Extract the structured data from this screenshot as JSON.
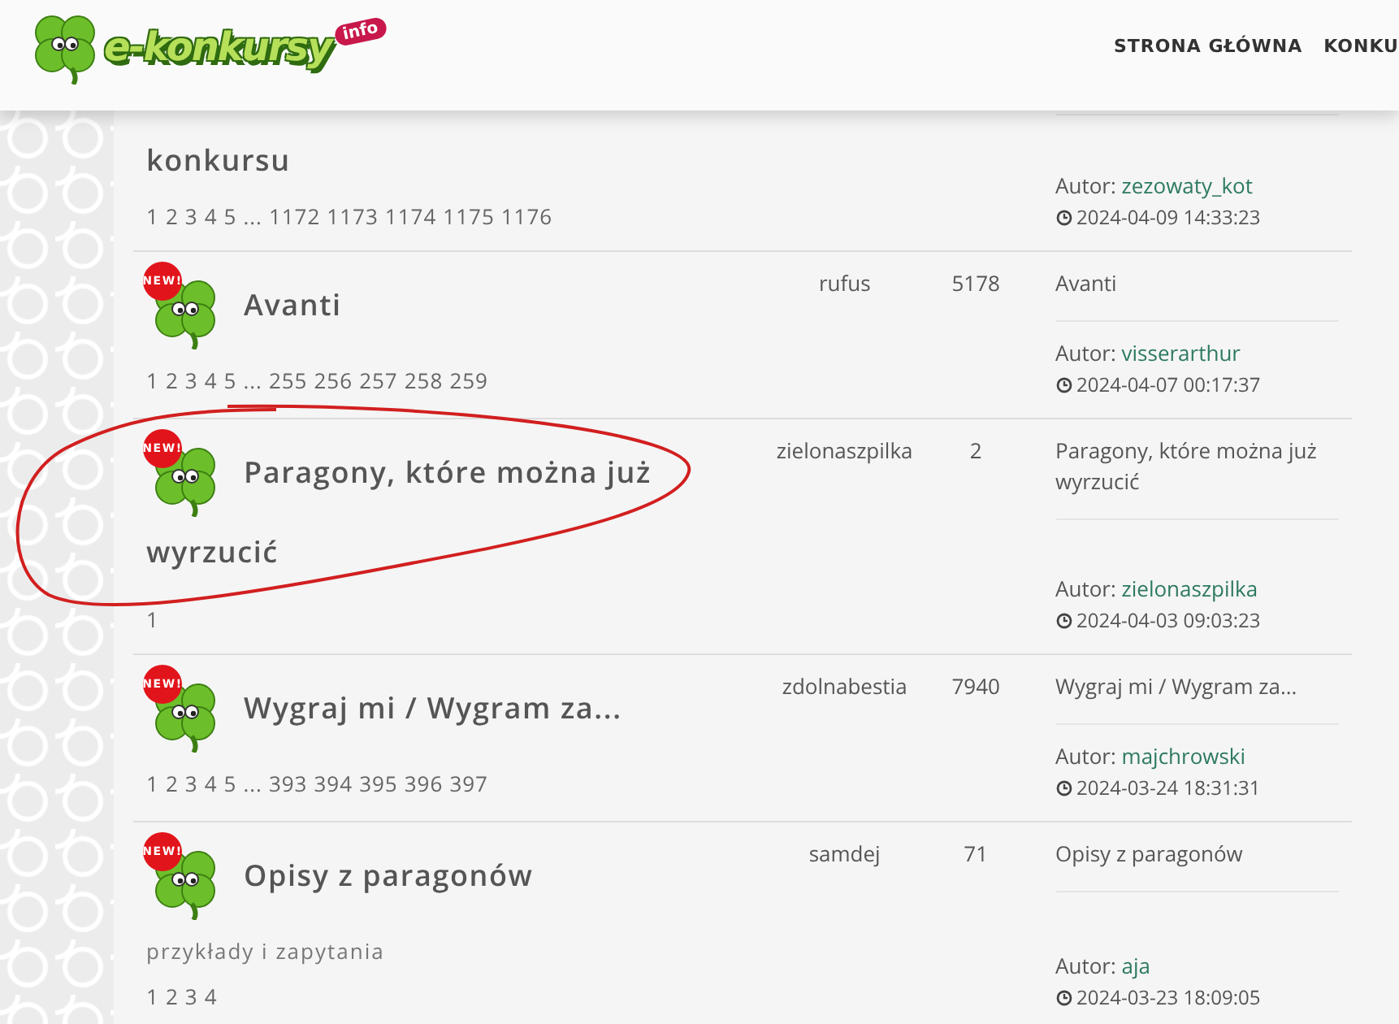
{
  "header": {
    "logo": {
      "text": "e-konkursy",
      "tag": "info"
    },
    "nav": [
      "STRONA GŁÓWNA",
      "KONKU"
    ]
  },
  "topics": [
    {
      "title": "konkursu",
      "pages": [
        "1",
        "2",
        "3",
        "4",
        "5",
        "...",
        "1172",
        "1173",
        "1174",
        "1175",
        "1176"
      ],
      "last_author_label": "Autor:",
      "last_author": "zezowaty_kot",
      "last_date": "2024-04-09 14:33:23",
      "circled": false
    },
    {
      "badge": "NEW!",
      "title": "Avanti",
      "pages": [
        "1",
        "2",
        "3",
        "4",
        "5",
        "...",
        "255",
        "256",
        "257",
        "258",
        "259"
      ],
      "author": "rufus",
      "count": "5178",
      "last_subject": "Avanti",
      "last_author_label": "Autor:",
      "last_author": "visserarthur",
      "last_date": "2024-04-07 00:17:37",
      "circled": false
    },
    {
      "badge": "NEW!",
      "title": "Paragony, które można już wyrzucić",
      "pages": [
        "1"
      ],
      "author": "zielonaszpilka",
      "count": "2",
      "last_subject": "Paragony, które można już wyrzucić",
      "last_author_label": "Autor:",
      "last_author": "zielonaszpilka",
      "last_date": "2024-04-03 09:03:23",
      "circled": true
    },
    {
      "badge": "NEW!",
      "title": "Wygraj mi / Wygram za...",
      "pages": [
        "1",
        "2",
        "3",
        "4",
        "5",
        "...",
        "393",
        "394",
        "395",
        "396",
        "397"
      ],
      "author": "zdolnabestia",
      "count": "7940",
      "last_subject": "Wygraj mi / Wygram za...",
      "last_author_label": "Autor:",
      "last_author": "majchrowski",
      "last_date": "2024-03-24 18:31:31",
      "circled": false
    },
    {
      "badge": "NEW!",
      "title": "Opisy z paragonów",
      "description": "przykłady i zapytania",
      "pages": [
        "1",
        "2",
        "3",
        "4"
      ],
      "author": "samdej",
      "count": "71",
      "last_subject": "Opisy z paragonów",
      "last_author_label": "Autor:",
      "last_author": "aja",
      "last_date": "2024-03-23 18:09:05",
      "circled": false
    }
  ]
}
